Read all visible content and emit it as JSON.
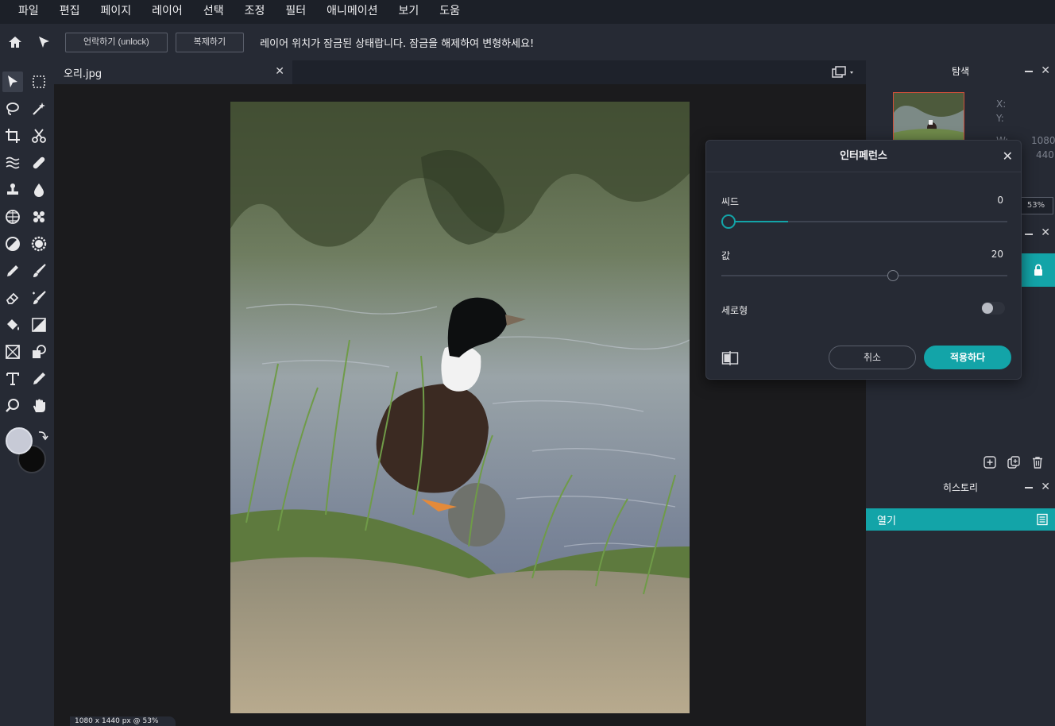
{
  "menu": [
    "파일",
    "편집",
    "페이지",
    "레이어",
    "선택",
    "조정",
    "필터",
    "애니메이션",
    "보기",
    "도움"
  ],
  "toolbar": {
    "unlock_label": "언락하기 (unlock)",
    "duplicate_label": "복제하기",
    "lock_message": "레이어 위치가 잠금된 상태랍니다. 잠금을 해제하여 변형하세요!"
  },
  "document": {
    "tab_name": "오리.jpg",
    "close_glyph": "✕",
    "status": "1080 x 1440 px @ 53%"
  },
  "navigator": {
    "title": "탐색",
    "x_label": "X:",
    "y_label": "Y:",
    "w_label": "W:",
    "w_value": "1080",
    "h_value": "440",
    "zoom": "53%"
  },
  "history": {
    "title": "히스토리",
    "items": [
      "열기"
    ]
  },
  "dialog": {
    "title": "인터페런스",
    "seed_label": "씨드",
    "seed_value": "0",
    "seed_fraction": 0.02,
    "value_label": "값",
    "value_value": "20",
    "value_fraction": 0.6,
    "vertical_label": "세로형",
    "vertical_on": false,
    "cancel_label": "취소",
    "apply_label": "적용하다"
  },
  "colors": {
    "accent": "#13a4a8",
    "foreground": "#c7cad6",
    "background": "#0c0c0c"
  }
}
